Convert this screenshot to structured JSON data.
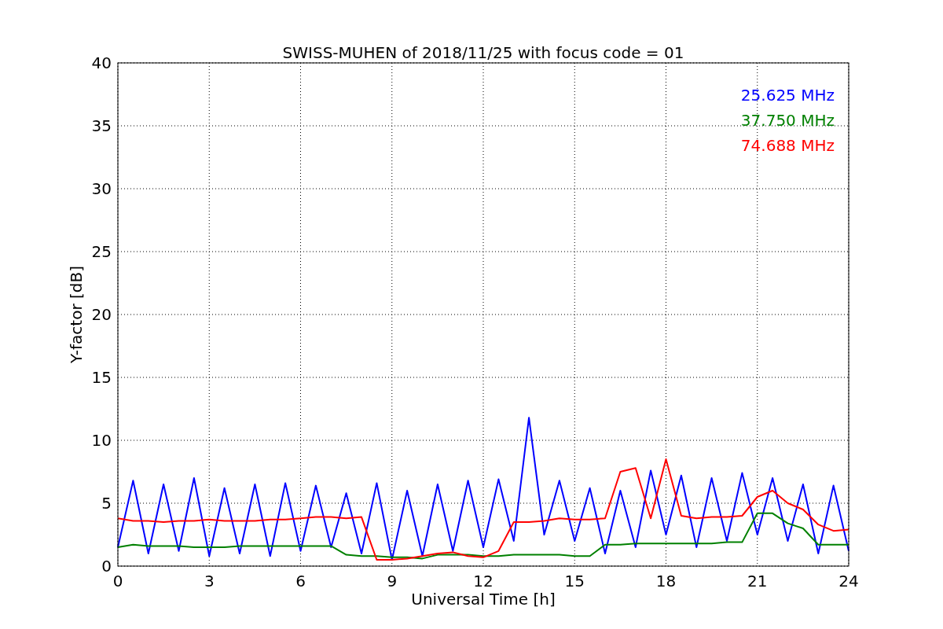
{
  "chart_data": {
    "type": "line",
    "title": "SWISS-MUHEN of 2018/11/25 with focus code = 01",
    "xlabel": "Universal Time [h]",
    "ylabel": "Y-factor [dB]",
    "x": [
      0,
      0.5,
      1,
      1.5,
      2,
      2.5,
      3,
      3.5,
      4,
      4.5,
      5,
      5.5,
      6,
      6.5,
      7,
      7.5,
      8,
      8.5,
      9,
      9.5,
      10,
      10.5,
      11,
      11.5,
      12,
      12.5,
      13,
      13.5,
      14,
      14.5,
      15,
      15.5,
      16,
      16.5,
      17,
      17.5,
      18,
      18.5,
      19,
      19.5,
      20,
      20.5,
      21,
      21.5,
      22,
      22.5,
      23,
      23.5,
      24
    ],
    "series": [
      {
        "name": "25.625 MHz",
        "color": "#0000ff",
        "values": [
          1.5,
          6.8,
          1.0,
          6.5,
          1.2,
          7.0,
          0.8,
          6.2,
          1.0,
          6.5,
          0.8,
          6.6,
          1.2,
          6.4,
          1.5,
          5.8,
          1.0,
          6.6,
          0.5,
          6.0,
          0.8,
          6.5,
          1.2,
          6.8,
          1.5,
          6.9,
          2.0,
          11.8,
          2.5,
          6.8,
          2.0,
          6.2,
          1.0,
          6.0,
          1.5,
          7.6,
          2.5,
          7.2,
          1.5,
          7.0,
          2.0,
          7.4,
          2.5,
          7.0,
          2.0,
          6.5,
          1.0,
          6.4,
          1.2
        ]
      },
      {
        "name": "37.750 MHz",
        "color": "#008000",
        "values": [
          1.5,
          1.7,
          1.6,
          1.6,
          1.6,
          1.5,
          1.5,
          1.5,
          1.6,
          1.6,
          1.6,
          1.6,
          1.6,
          1.6,
          1.6,
          0.9,
          0.8,
          0.8,
          0.7,
          0.7,
          0.6,
          0.9,
          0.9,
          0.9,
          0.8,
          0.8,
          0.9,
          0.9,
          0.9,
          0.9,
          0.8,
          0.8,
          1.7,
          1.7,
          1.8,
          1.8,
          1.8,
          1.8,
          1.8,
          1.8,
          1.9,
          1.9,
          4.2,
          4.2,
          3.4,
          3.0,
          1.7,
          1.7,
          1.7
        ]
      },
      {
        "name": "74.688 MHz",
        "color": "#ff0000",
        "values": [
          3.8,
          3.6,
          3.6,
          3.5,
          3.6,
          3.6,
          3.7,
          3.6,
          3.6,
          3.6,
          3.7,
          3.7,
          3.8,
          3.9,
          3.9,
          3.8,
          3.9,
          0.5,
          0.5,
          0.6,
          0.8,
          1.0,
          1.1,
          0.8,
          0.7,
          1.2,
          3.5,
          3.5,
          3.6,
          3.8,
          3.7,
          3.7,
          3.8,
          7.5,
          7.8,
          3.8,
          8.5,
          4.0,
          3.8,
          3.9,
          3.9,
          4.0,
          5.5,
          6.0,
          5.0,
          4.5,
          3.3,
          2.8,
          2.9
        ]
      }
    ],
    "grid": true,
    "xlim": [
      0,
      24
    ],
    "ylim": [
      0,
      40
    ],
    "xticks": [
      0,
      3,
      6,
      9,
      12,
      15,
      18,
      21,
      24
    ],
    "yticks": [
      0,
      5,
      10,
      15,
      20,
      25,
      30,
      35,
      40
    ]
  }
}
